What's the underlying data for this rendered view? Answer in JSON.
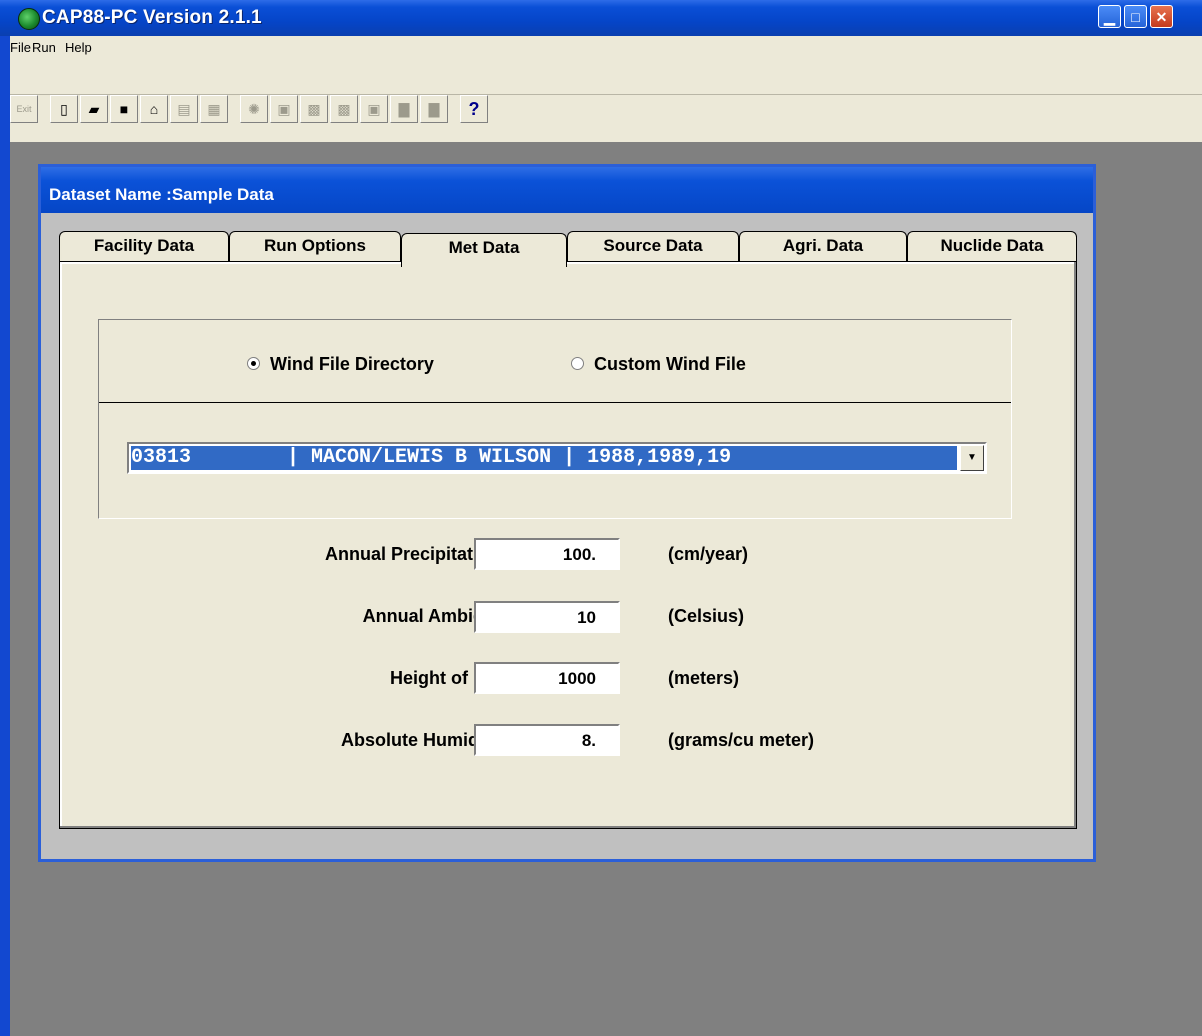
{
  "window": {
    "title": "CAP88-PC Version 2.1.1"
  },
  "menu": {
    "items": [
      "File",
      "Run",
      "Help"
    ]
  },
  "toolbar": {
    "exit_label": "Exit",
    "help_label": "?"
  },
  "dataset": {
    "title": "Dataset Name :Sample Data"
  },
  "tabs": [
    {
      "label": "Facility Data",
      "active": false
    },
    {
      "label": "Run Options",
      "active": false
    },
    {
      "label": "Met Data",
      "active": true
    },
    {
      "label": "Source Data",
      "active": false
    },
    {
      "label": "Agri. Data",
      "active": false
    },
    {
      "label": "Nuclide Data",
      "active": false
    }
  ],
  "wind": {
    "option_directory": "Wind File Directory",
    "option_custom": "Custom Wind File",
    "selected_option": "Wind File Directory",
    "station": "03813        | MACON/LEWIS B WILSON | 1988,1989,19"
  },
  "fields": [
    {
      "label": "Annual Precipitation:",
      "value": "100.",
      "unit": "(cm/year)"
    },
    {
      "label": "Annual Ambient:",
      "value": "10",
      "unit": "(Celsius)"
    },
    {
      "label": "Height of Lid:",
      "value": "1000",
      "unit": "(meters)"
    },
    {
      "label": "Absolute Humidity:",
      "value": "8.",
      "unit": "(grams/cu meter)"
    }
  ]
}
